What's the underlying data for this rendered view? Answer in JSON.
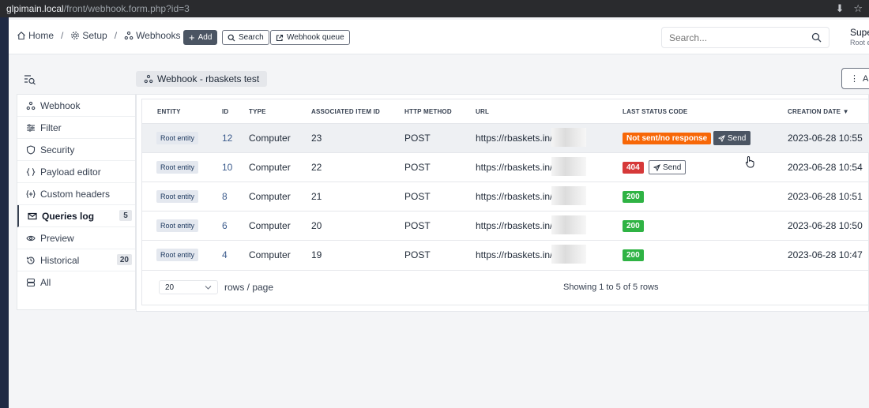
{
  "browser": {
    "host": "glpimain.local",
    "path": "/front/webhook.form.php?id=3"
  },
  "breadcrumb": {
    "home": "Home",
    "setup": "Setup",
    "webhooks": "Webhooks"
  },
  "toolbar": {
    "add": "Add",
    "search": "Search",
    "queue": "Webhook queue"
  },
  "search": {
    "placeholder": "Search..."
  },
  "user": {
    "name": "Super-Admin",
    "entity": "Root entity"
  },
  "title": "Webhook - rbaskets test",
  "actions_label": "A",
  "sidebar": {
    "items": [
      {
        "label": "Webhook",
        "icon": "webhook-icon"
      },
      {
        "label": "Filter",
        "icon": "filter-icon"
      },
      {
        "label": "Security",
        "icon": "shield-icon"
      },
      {
        "label": "Payload editor",
        "icon": "braces-icon"
      },
      {
        "label": "Custom headers",
        "icon": "header-icon"
      },
      {
        "label": "Queries log",
        "icon": "mail-icon",
        "count": "5",
        "active": true
      },
      {
        "label": "Preview",
        "icon": "eye-icon"
      },
      {
        "label": "Historical",
        "icon": "history-icon",
        "count": "20"
      },
      {
        "label": "All",
        "icon": "stack-icon"
      }
    ]
  },
  "table": {
    "headers": {
      "entity": "ENTITY",
      "id": "ID",
      "type": "TYPE",
      "item": "ASSOCIATED ITEM ID",
      "method": "HTTP METHOD",
      "url": "URL",
      "status": "LAST STATUS CODE",
      "date": "CREATION DATE"
    },
    "rows": [
      {
        "entity": "Root entity",
        "id": "12",
        "type": "Computer",
        "item": "23",
        "method": "POST",
        "url": "https://rbaskets.in/",
        "status": "Not sent/no response",
        "status_kind": "warn",
        "send": "Send",
        "date": "2023-06-28 10:55"
      },
      {
        "entity": "Root entity",
        "id": "10",
        "type": "Computer",
        "item": "22",
        "method": "POST",
        "url": "https://rbaskets.in/",
        "status": "404",
        "status_kind": "err",
        "send": "Send",
        "date": "2023-06-28 10:54"
      },
      {
        "entity": "Root entity",
        "id": "8",
        "type": "Computer",
        "item": "21",
        "method": "POST",
        "url": "https://rbaskets.in/",
        "status": "200",
        "status_kind": "ok",
        "date": "2023-06-28 10:51"
      },
      {
        "entity": "Root entity",
        "id": "6",
        "type": "Computer",
        "item": "20",
        "method": "POST",
        "url": "https://rbaskets.in/",
        "status": "200",
        "status_kind": "ok",
        "date": "2023-06-28 10:50"
      },
      {
        "entity": "Root entity",
        "id": "4",
        "type": "Computer",
        "item": "19",
        "method": "POST",
        "url": "https://rbaskets.in/",
        "status": "200",
        "status_kind": "ok",
        "date": "2023-06-28 10:47"
      }
    ]
  },
  "pager": {
    "page_size": "20",
    "per_page": "rows / page",
    "showing": "Showing 1 to 5 of 5 rows"
  },
  "colors": {
    "warn": "#f76707",
    "err": "#d63939",
    "ok": "#2fb344",
    "dark_button": "#4b5563"
  }
}
